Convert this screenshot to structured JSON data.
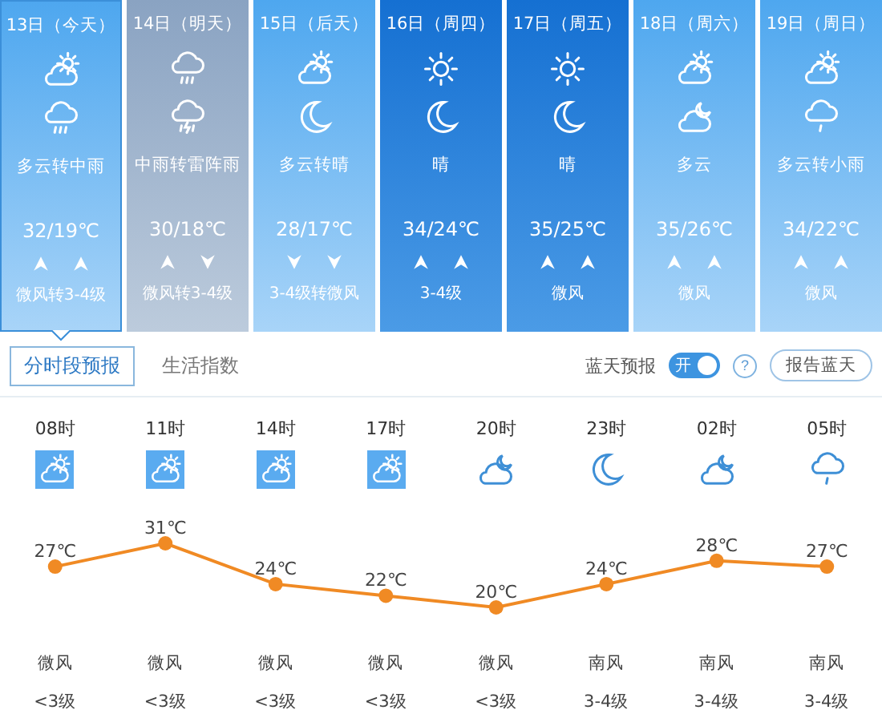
{
  "days": [
    {
      "date": "13日（今天）",
      "kind": "cloudy",
      "selected": true,
      "icons": [
        {
          "kind": "partly_cloudy"
        },
        {
          "kind": "rain"
        }
      ],
      "desc": "多云转中雨",
      "temp": "32/19℃",
      "winds": [
        {
          "kind": "up"
        },
        {
          "kind": "up"
        }
      ],
      "wind": "微风转3-4级"
    },
    {
      "date": "14日（明天）",
      "kind": "rain",
      "selected": false,
      "icons": [
        {
          "kind": "rain"
        },
        {
          "kind": "thunder"
        }
      ],
      "desc": "中雨转雷阵雨",
      "temp": "30/18℃",
      "winds": [
        {
          "kind": "up"
        },
        {
          "kind": "down"
        }
      ],
      "wind": "微风转3-4级"
    },
    {
      "date": "15日（后天）",
      "kind": "cloudy",
      "selected": false,
      "icons": [
        {
          "kind": "partly_cloudy"
        },
        {
          "kind": "moon"
        }
      ],
      "desc": "多云转晴",
      "temp": "28/17℃",
      "winds": [
        {
          "kind": "down"
        },
        {
          "kind": "down"
        }
      ],
      "wind": "3-4级转微风"
    },
    {
      "date": "16日（周四）",
      "kind": "clear",
      "selected": false,
      "icons": [
        {
          "kind": "sun"
        },
        {
          "kind": "moon"
        }
      ],
      "desc": "晴",
      "temp": "34/24℃",
      "winds": [
        {
          "kind": "up"
        },
        {
          "kind": "up"
        }
      ],
      "wind": "3-4级"
    },
    {
      "date": "17日（周五）",
      "kind": "clear",
      "selected": false,
      "icons": [
        {
          "kind": "sun"
        },
        {
          "kind": "moon"
        }
      ],
      "desc": "晴",
      "temp": "35/25℃",
      "winds": [
        {
          "kind": "up"
        },
        {
          "kind": "up"
        }
      ],
      "wind": "微风"
    },
    {
      "date": "18日（周六）",
      "kind": "cloudy",
      "selected": false,
      "icons": [
        {
          "kind": "partly_cloudy"
        },
        {
          "kind": "night_cloudy"
        }
      ],
      "desc": "多云",
      "temp": "35/26℃",
      "winds": [
        {
          "kind": "up"
        },
        {
          "kind": "up"
        }
      ],
      "wind": "微风"
    },
    {
      "date": "19日（周日）",
      "kind": "cloudy",
      "selected": false,
      "icons": [
        {
          "kind": "partly_cloudy"
        },
        {
          "kind": "light_rain"
        }
      ],
      "desc": "多云转小雨",
      "temp": "34/22℃",
      "winds": [
        {
          "kind": "up"
        },
        {
          "kind": "up"
        }
      ],
      "wind": "微风"
    }
  ],
  "tabs": [
    {
      "label": "分时段预报",
      "selected": true
    },
    {
      "label": "生活指数",
      "selected": false
    }
  ],
  "bluesky": {
    "label": "蓝天预报",
    "toggle": {
      "on": true,
      "label": "开"
    },
    "help": "?",
    "button": "报告蓝天"
  },
  "hours": [
    {
      "time": "08时",
      "kind": "partly_cloudy",
      "wind": "微风",
      "level": "<3级"
    },
    {
      "time": "11时",
      "kind": "partly_cloudy",
      "wind": "微风",
      "level": "<3级"
    },
    {
      "time": "14时",
      "kind": "partly_cloudy",
      "wind": "微风",
      "level": "<3级"
    },
    {
      "time": "17时",
      "kind": "partly_cloudy",
      "wind": "微风",
      "level": "<3级"
    },
    {
      "time": "20时",
      "kind": "night_cloudy",
      "wind": "微风",
      "level": "<3级"
    },
    {
      "time": "23时",
      "kind": "moon",
      "wind": "南风",
      "level": "3-4级"
    },
    {
      "time": "02时",
      "kind": "night_cloudy",
      "wind": "南风",
      "level": "3-4级"
    },
    {
      "time": "05时",
      "kind": "light_rain",
      "wind": "南风",
      "level": "3-4级"
    }
  ],
  "chart_data": {
    "type": "line",
    "series": [
      {
        "color": "#f08a24",
        "marker": "circle",
        "values": [
          27,
          31,
          24,
          22,
          20,
          24,
          28,
          27
        ]
      }
    ],
    "data_labels": true
  },
  "temperature_unit": "℃"
}
